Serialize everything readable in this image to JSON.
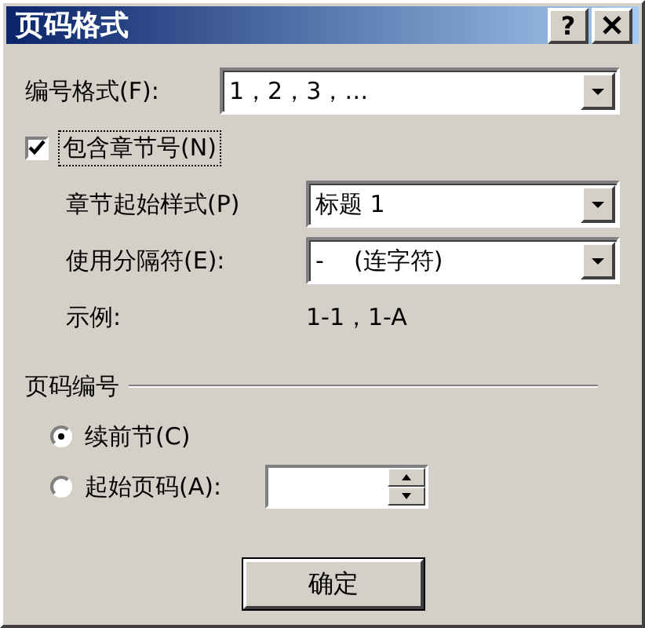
{
  "window": {
    "title": "页码格式",
    "help_button": "?"
  },
  "number_format": {
    "label": "编号格式(F):",
    "value": "1，2，3，…"
  },
  "include_chapter": {
    "label": "包含章节号(N)",
    "checked": true,
    "focused": true
  },
  "chapter_style": {
    "label": "章节起始样式(P)",
    "value": "标题 1"
  },
  "separator": {
    "label": "使用分隔符(E):",
    "value": "-    (连字符)"
  },
  "example": {
    "label": "示例:",
    "value": "1-1，1-A"
  },
  "page_numbering": {
    "title": "页码编号",
    "options": [
      {
        "label": "续前节(C)",
        "selected": true,
        "kind": "plain"
      },
      {
        "label": "起始页码(A):",
        "selected": false,
        "kind": "spin"
      }
    ]
  },
  "buttons": [
    {
      "label": "确定",
      "default": true
    }
  ]
}
